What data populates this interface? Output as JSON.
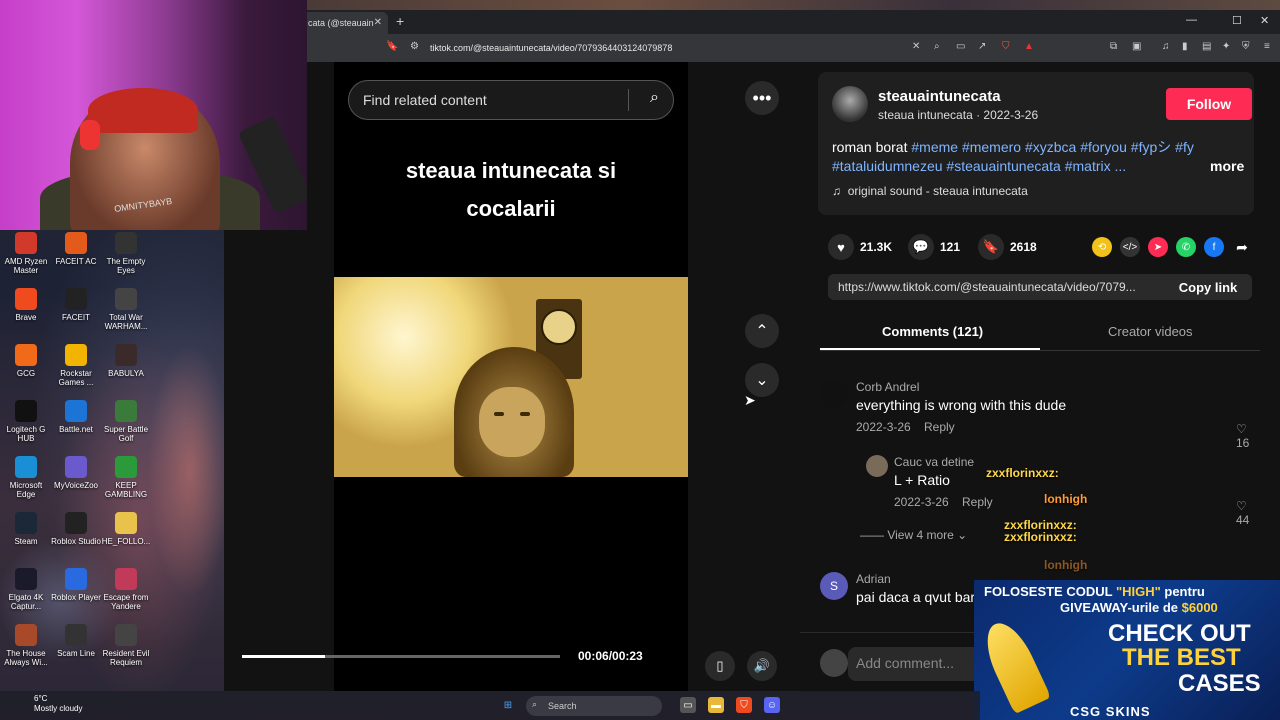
{
  "browser": {
    "tab_title": "cata (@steauain",
    "tab_close": "✕",
    "new_tab": "+",
    "url": "tiktok.com/@steauaintunecata/video/7079364403124079878",
    "min": "—",
    "max": "☐",
    "close": "✕"
  },
  "search": {
    "placeholder": "Find related content"
  },
  "video": {
    "title_line1": "steaua intunecata si",
    "title_line2": "cocalarii",
    "time": "00:06/00:23",
    "progress": 0.26
  },
  "author": {
    "username": "steauaintunecata",
    "subtitle": "steaua intunecata · 2022-3-26",
    "follow_label": "Follow",
    "desc_plain": "roman borat ",
    "tags_line1": "#meme #memero #xyzbca #foryou #fypシ #fy",
    "tags_line2": "#tataluidumnezeu #steauaintunecata #matrix ...",
    "more": "more",
    "sound": "original sound - steaua intunecata"
  },
  "stats": {
    "likes": "21.3K",
    "comments": "121",
    "saves": "2618"
  },
  "link": {
    "url": "https://www.tiktok.com/@steauaintunecata/video/7079...",
    "copy": "Copy link"
  },
  "tabs": {
    "comments": "Comments (121)",
    "creator": "Creator videos"
  },
  "comments": [
    {
      "user": "Corb Andrel",
      "text": "everything is wrong with this dude",
      "date": "2022-3-26",
      "reply": "Reply",
      "likes": "16"
    },
    {
      "user": "Cauc va detine",
      "text": "L + Ratio",
      "date": "2022-3-26",
      "reply": "Reply",
      "likes": "44"
    },
    {
      "user": "Adrian",
      "text": "pai daca a qvut bar",
      "initial": "S"
    }
  ],
  "view_more": "View 4 more",
  "add_comment": {
    "placeholder": "Add comment..."
  },
  "desktop_icons": [
    {
      "label": "AMD Ryzen Master",
      "color": "#d13a2a"
    },
    {
      "label": "FACEIT AC",
      "color": "#e35a1a"
    },
    {
      "label": "The Empty Eyes",
      "color": "#333"
    },
    {
      "label": "Brave",
      "color": "#f04a1f"
    },
    {
      "label": "FACEIT",
      "color": "#222"
    },
    {
      "label": "Total War WARHAM...",
      "color": "#444"
    },
    {
      "label": "GCG",
      "color": "#f06a1a"
    },
    {
      "label": "Rockstar Games ...",
      "color": "#f2b400"
    },
    {
      "label": "BABULYA",
      "color": "#3a2a2a"
    },
    {
      "label": "Logitech G HUB",
      "color": "#111"
    },
    {
      "label": "Battle.net",
      "color": "#1c74d6"
    },
    {
      "label": "Super Battle Golf",
      "color": "#3a7a3a"
    },
    {
      "label": "Microsoft Edge",
      "color": "#1b8fd6"
    },
    {
      "label": "MyVoiceZoo",
      "color": "#6a5acd"
    },
    {
      "label": "KEEP GAMBLING",
      "color": "#2a9a3a"
    },
    {
      "label": "Steam",
      "color": "#1b2838"
    },
    {
      "label": "Roblox Studio",
      "color": "#222"
    },
    {
      "label": "HE_FOLLO...",
      "color": "#e8c24a"
    },
    {
      "label": "Elgato 4K Captur...",
      "color": "#1a1a2a"
    },
    {
      "label": "Roblox Player",
      "color": "#2a6ae0"
    },
    {
      "label": "Escape from Yandere",
      "color": "#c23a5a"
    },
    {
      "label": "The House Always Wi...",
      "color": "#a84a2a"
    },
    {
      "label": "Scam Line",
      "color": "#333"
    },
    {
      "label": "Resident Evil Requiem",
      "color": "#444"
    }
  ],
  "webcam": {
    "shirt_text": "OMNITYBAYB"
  },
  "chat": [
    {
      "text": "zxxflorinxxz:"
    },
    {
      "text": "lonhigh"
    },
    {
      "text": "zxxflorinxxz:"
    },
    {
      "text": "zxxflorinxxz:"
    },
    {
      "text": "lonhigh"
    }
  ],
  "promo": {
    "line1_a": "FOLOSESTE CODUL ",
    "line1_b": "\"HIGH\"",
    "line1_c": " pentru",
    "line2_a": "GIVEAWAY-urile de ",
    "line2_b": "$6000",
    "big1": "CHECK OUT",
    "big2": "THE BEST",
    "big3": "CASES",
    "brand": "CSG SKINS"
  },
  "taskbar": {
    "temp": "6°C",
    "weather": "Mostly cloudy",
    "search": "Search"
  }
}
